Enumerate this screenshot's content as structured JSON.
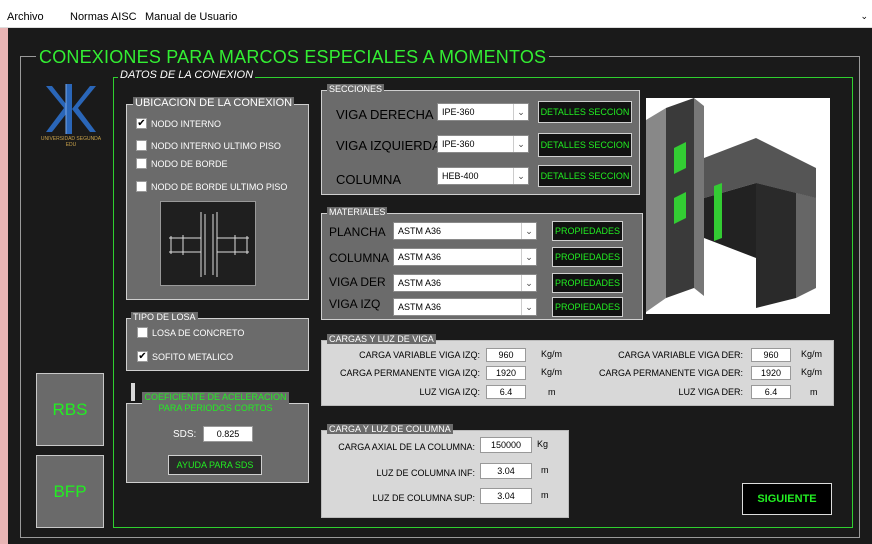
{
  "menu": {
    "items": [
      "Archivo",
      "Normas AISC",
      "Manual de Usuario"
    ],
    "arrow": "⌄"
  },
  "main": {
    "title": "CONEXIONES PARA MARCOS ESPECIALES A MOMENTOS",
    "group_title": "DATOS DE LA CONEXION"
  },
  "logo": {
    "text": "UNIVERSIDAD SEGUNDA EDU"
  },
  "ubicacion": {
    "title": "UBICACION DE LA CONEXION",
    "options": [
      {
        "label": "NODO INTERNO",
        "checked": true
      },
      {
        "label": "NODO INTERNO ULTIMO PISO",
        "checked": false
      },
      {
        "label": "NODO DE BORDE",
        "checked": false
      },
      {
        "label": "NODO DE BORDE ULTIMO PISO",
        "checked": false
      }
    ]
  },
  "losa": {
    "title": "TIPO DE LOSA",
    "options": [
      {
        "label": "LOSA DE CONCRETO",
        "checked": false
      },
      {
        "label": "SOFITO METALICO",
        "checked": true
      }
    ]
  },
  "sds": {
    "title": "COEFICIENTE DE ACELERACION PARA PERIODOS CORTOS",
    "label": "SDS:",
    "value": "0.825",
    "help_button": "AYUDA PARA SDS"
  },
  "left_buttons": {
    "rbs": "RBS",
    "bfp": "BFP"
  },
  "secciones": {
    "title": "SECCIONES",
    "rows": [
      {
        "label": "VIGA DERECHA",
        "value": "IPE-360",
        "button": "DETALLES SECCION"
      },
      {
        "label": "VIGA IZQUIERDA",
        "value": "IPE-360",
        "button": "DETALLES SECCION"
      },
      {
        "label": "COLUMNA",
        "value": "HEB-400",
        "button": "DETALLES SECCION"
      }
    ]
  },
  "materiales": {
    "title": "MATERIALES",
    "rows": [
      {
        "label": "PLANCHA",
        "value": "ASTM A36",
        "button": "PROPIEDADES"
      },
      {
        "label": "COLUMNA",
        "value": "ASTM A36",
        "button": "PROPIEDADES"
      },
      {
        "label": "VIGA DER",
        "value": "ASTM A36",
        "button": "PROPIEDADES"
      },
      {
        "label": "VIGA IZQ",
        "value": "ASTM A36",
        "button": "PROPIEDADES"
      }
    ]
  },
  "cargas_viga": {
    "title": "CARGAS Y LUZ DE VIGA",
    "left": [
      {
        "label": "CARGA VARIABLE VIGA IZQ:",
        "value": "960",
        "unit": "Kg/m"
      },
      {
        "label": "CARGA PERMANENTE  VIGA IZQ:",
        "value": "1920",
        "unit": "Kg/m"
      },
      {
        "label": "LUZ  VIGA IZQ:",
        "value": "6.4",
        "unit": "m"
      }
    ],
    "right": [
      {
        "label": "CARGA VARIABLE VIGA DER:",
        "value": "960",
        "unit": "Kg/m"
      },
      {
        "label": "CARGA PERMANENTE VIGA DER:",
        "value": "1920",
        "unit": "Kg/m"
      },
      {
        "label": "LUZ VIGA DER:",
        "value": "6.4",
        "unit": "m"
      }
    ]
  },
  "cargas_columna": {
    "title": "CARGA Y LUZ DE COLUMNA",
    "rows": [
      {
        "label": "CARGA AXIAL DE LA COLUMNA:",
        "value": "150000",
        "unit": "Kg"
      },
      {
        "label": "LUZ DE COLUMNA INF:",
        "value": "3.04",
        "unit": "m"
      },
      {
        "label": "LUZ DE COLUMNA SUP:",
        "value": "3.04",
        "unit": "m"
      }
    ]
  },
  "next_button": "SIGUIENTE",
  "colors": {
    "accent_green": "#22ee22",
    "window_bg": "#1a1a1a",
    "panel_bg": "#6b6b6b",
    "logo_blue": "#2a66b8"
  }
}
